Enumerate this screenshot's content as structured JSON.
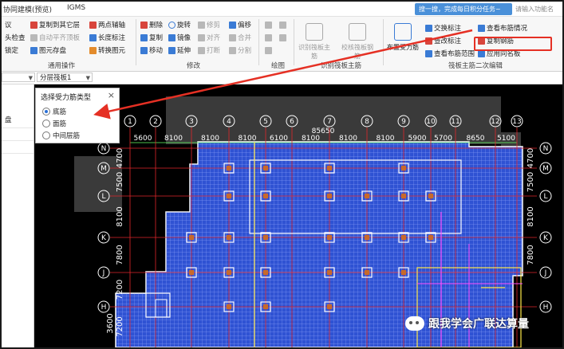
{
  "titlebar": {
    "app_title": "协同建模(预览)",
    "app_name": "IGMS",
    "tip_banner": "搜一搜，完成每日积分任务~",
    "search_placeholder": "请输入功能名"
  },
  "ribbon": {
    "col0": [
      "议",
      "头检查",
      "锁定"
    ],
    "col1": [
      "复制到其它层",
      "自动平齐顶板",
      "图元存盘"
    ],
    "col2": [
      "两点辅轴",
      "长度标注",
      "转换图元"
    ],
    "group_common": "通用操作",
    "modify": {
      "delete": "删除",
      "rotate": "旋转",
      "trim": "修剪",
      "offset": "偏移",
      "copy": "复制",
      "mirror": "镜像",
      "align": "对齐",
      "merge": "合并",
      "move": "移动",
      "extend": "延伸",
      "break": "打断",
      "split": "分割",
      "group": "修改"
    },
    "draw_group": "绘图",
    "recognize": {
      "btn1": "识别筏板主筋",
      "btn2": "校核筏板钢筋",
      "btn3": "布置受力筋",
      "group": "识别筏板主筋"
    },
    "secondary": {
      "swap_label": "交换标注",
      "view_layout": "查看布筋情况",
      "view_label": "查改标注",
      "copy_rebar": "复制钢筋",
      "view_range": "查看布筋范围",
      "apply_same": "应用同名板",
      "group": "筏板主筋二次编辑"
    }
  },
  "toolbar": {
    "dropdown1": "",
    "dropdown2": "分层筏板1"
  },
  "leftpanel": {
    "label": "盘"
  },
  "popup": {
    "title": "选择受力筋类型",
    "close": "×",
    "options": [
      "底筋",
      "面筋",
      "中间层筋"
    ],
    "selected": "底筋"
  },
  "grid": {
    "top_axes": [
      "1",
      "2",
      "3",
      "4",
      "5",
      "6",
      "7",
      "8",
      "9",
      "10",
      "11",
      "12",
      "13"
    ],
    "top_dims": [
      "5600",
      "8100",
      "8100",
      "8100",
      "6100",
      "8100",
      "8100",
      "8100",
      "5900",
      "5700",
      "8650",
      "5100"
    ],
    "total_dim": "85650",
    "side_axes": [
      "N",
      "M",
      "L",
      "K",
      "J",
      "H"
    ],
    "left_dims": [
      "4700",
      "7500",
      "8100",
      "7800",
      "7200",
      "7200"
    ],
    "right_dims": [
      "4700",
      "7500",
      "8100",
      "7800"
    ],
    "extra_dim": "3600"
  },
  "watermark": "跟我学会广联达算量",
  "colors": {
    "canvas_bg": "#000000",
    "slab_fill": "#2f52d3",
    "rebar_mesh": "#9fb0ff",
    "axis_line": "#e0262a",
    "highlight_border": "#e53024",
    "banner": "#4a90d9"
  }
}
